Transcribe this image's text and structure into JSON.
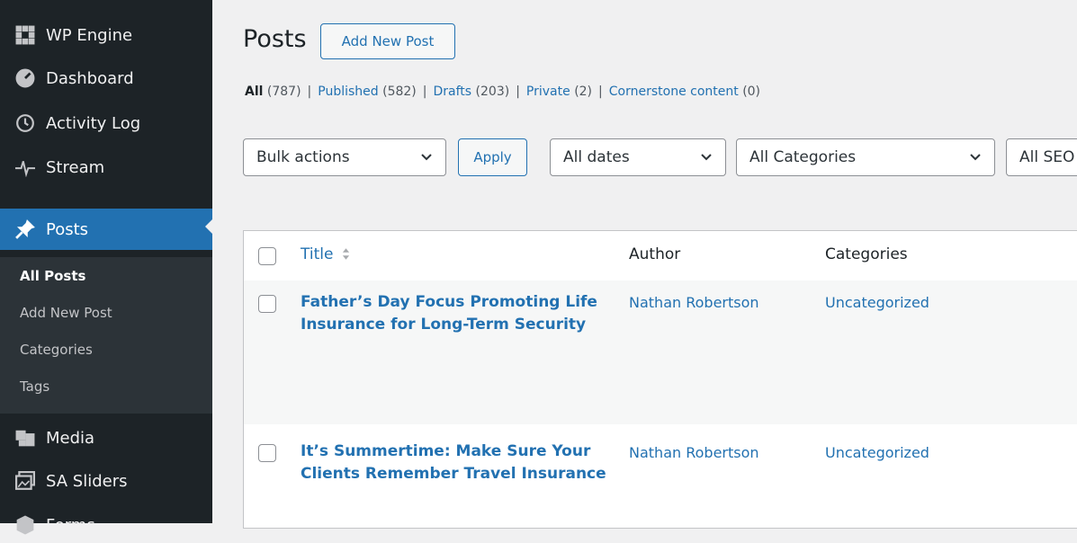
{
  "sidebar": {
    "items": [
      {
        "label": "WP Engine",
        "icon": "wp-engine-icon"
      },
      {
        "label": "Dashboard",
        "icon": "dashboard-icon"
      },
      {
        "label": "Activity Log",
        "icon": "history-icon"
      },
      {
        "label": "Stream",
        "icon": "pulse-icon"
      },
      {
        "label": "Posts",
        "icon": "pin-icon",
        "active": true
      },
      {
        "label": "Media",
        "icon": "media-icon"
      },
      {
        "label": "SA Sliders",
        "icon": "slides-icon"
      },
      {
        "label": "Forms",
        "icon": "forms-icon"
      }
    ],
    "submenu": [
      {
        "label": "All Posts",
        "current": true
      },
      {
        "label": "Add New Post"
      },
      {
        "label": "Categories"
      },
      {
        "label": "Tags"
      }
    ]
  },
  "header": {
    "title": "Posts",
    "add_new_label": "Add New Post"
  },
  "filters_links": [
    {
      "label": "All",
      "count": "(787)",
      "current": true
    },
    {
      "label": "Published",
      "count": "(582)"
    },
    {
      "label": "Drafts",
      "count": "(203)"
    },
    {
      "label": "Private",
      "count": "(2)"
    },
    {
      "label": "Cornerstone content",
      "count": "(0)"
    }
  ],
  "toolbar": {
    "bulk_actions": "Bulk actions",
    "apply_label": "Apply",
    "dates": "All dates",
    "categories": "All Categories",
    "seo": "All SEO"
  },
  "table": {
    "columns": [
      "Title",
      "Author",
      "Categories"
    ],
    "rows": [
      {
        "title": "Father’s Day Focus Promoting Life Insurance for Long-Term Security",
        "author": "Nathan Robertson",
        "category": "Uncategorized"
      },
      {
        "title": "It’s Summertime: Make Sure Your Clients Remember Travel Insurance",
        "author": "Nathan Robertson",
        "category": "Uncategorized"
      }
    ]
  },
  "colors": {
    "sidebar_bg": "#1d2327",
    "accent": "#2271b1",
    "submenu_bg": "#2c3338"
  }
}
